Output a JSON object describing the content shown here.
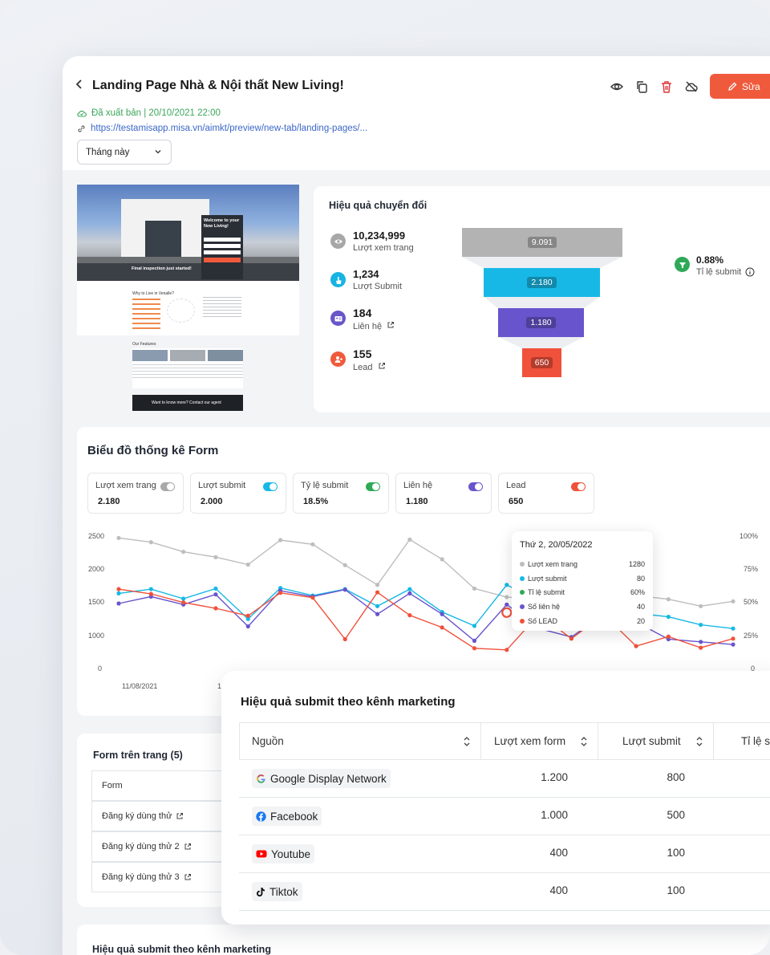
{
  "header": {
    "title": "Landing Page Nhà & Nội thất New Living!",
    "status": "Đã xuất bản | 20/10/2021  22:00",
    "url": "https://testamisapp.misa.vn/aimkt/preview/new-tab/landing-pages/...",
    "period": "Tháng này",
    "edit_label": "Sửa",
    "icons": [
      "eye-icon",
      "copy-icon",
      "trash-icon",
      "cloud-off-icon",
      "pencil-icon"
    ],
    "accent": "#f05a3c"
  },
  "preview": {
    "hero_heading": "Welcome to your New Living!",
    "banner": "Final inspection just started!",
    "section": "Why to Live in Venalle?",
    "features": "Our Features",
    "cta": "Want to know more? Contact our agent"
  },
  "conversion": {
    "title": "Hiệu quả chuyển đổi",
    "metrics": [
      {
        "value": "10,234,999",
        "label": "Lượt xem trang",
        "color": "#a7a7a7",
        "icon": "eye-icon"
      },
      {
        "value": "1,234",
        "label": "Lượt Submit",
        "color": "#17b3e3",
        "icon": "hand-pointer-icon"
      },
      {
        "value": "184",
        "label": "Liên hệ",
        "color": "#6a55c9",
        "icon": "contact-card-icon"
      },
      {
        "value": "155",
        "label": "Lead",
        "color": "#f05a3c",
        "icon": "user-plus-icon"
      }
    ],
    "funnel": [
      {
        "label": "9.091",
        "color": "#b3b3b3"
      },
      {
        "label": "2.180",
        "color": "#17b8e6"
      },
      {
        "label": "1.180",
        "color": "#6854cc"
      },
      {
        "label": "650",
        "color": "#f0513b"
      }
    ],
    "ratio_value": "0.88%",
    "ratio_label": "Tỉ lệ submit"
  },
  "chart_card": {
    "title": "Biểu đồ thống kê Form",
    "stats": [
      {
        "label": "Lượt xem trang",
        "value": "2.180",
        "color": "#a9a9a9"
      },
      {
        "label": "Lượt submit",
        "value": "2.000",
        "color": "#17b8e6"
      },
      {
        "label": "Tỷ lệ submit",
        "value": "18.5%",
        "color": "#2fa958"
      },
      {
        "label": "Liên hệ",
        "value": "1.180",
        "color": "#6854cc"
      },
      {
        "label": "Lead",
        "value": "650",
        "color": "#f0513b"
      }
    ],
    "tooltip": {
      "title": "Thứ 2, 20/05/2022",
      "rows": [
        {
          "label": "Lượt xem trang",
          "value": "1280",
          "color": "#bdbdbd"
        },
        {
          "label": "Lượt submit",
          "value": "80",
          "color": "#17b8e6"
        },
        {
          "label": "Tỉ lệ submit",
          "value": "60%",
          "color": "#2fa958"
        },
        {
          "label": "Số liên hệ",
          "value": "40",
          "color": "#6854cc"
        },
        {
          "label": "Số LEAD",
          "value": "20",
          "color": "#f0513b"
        }
      ]
    }
  },
  "chart_data": {
    "type": "line",
    "x": [
      "11/08/2021",
      "",
      "",
      "",
      "",
      "",
      "",
      "",
      "",
      "",
      "",
      "",
      "",
      "",
      "",
      "",
      "",
      "",
      "",
      ""
    ],
    "x_tick_labels": [
      "11/08/2021",
      "1"
    ],
    "y_left_ticks": [
      "2500",
      "2000",
      "1500",
      "1000",
      "0"
    ],
    "y_right_ticks": [
      "100%",
      "75%",
      "50%",
      "25%",
      "0"
    ],
    "ylim": [
      0,
      2500
    ],
    "series": [
      {
        "color": "#bdbdbd",
        "values": [
          2480,
          2400,
          2220,
          2120,
          1980,
          2440,
          2360,
          1970,
          1600,
          2450,
          2080,
          1530,
          1370,
          1330,
          1480,
          1650,
          1400,
          1330,
          1200,
          1290
        ]
      },
      {
        "color": "#17b8e6",
        "values": [
          1440,
          1520,
          1340,
          1530,
          960,
          1540,
          1400,
          1520,
          1200,
          1520,
          1090,
          830,
          1600,
          1290,
          1020,
          800,
          1070,
          1000,
          850,
          780
        ]
      },
      {
        "color": "#6854cc",
        "values": [
          1250,
          1380,
          1230,
          1420,
          820,
          1490,
          1380,
          1510,
          1050,
          1440,
          1050,
          550,
          1230,
          780,
          620,
          1050,
          900,
          580,
          530,
          480
        ]
      },
      {
        "color": "#f0513b",
        "values": [
          1520,
          1430,
          1270,
          1160,
          1020,
          1450,
          1360,
          580,
          1460,
          1030,
          800,
          410,
          380,
          1050,
          590,
          1040,
          450,
          630,
          420,
          590
        ]
      }
    ],
    "highlight_index": 12
  },
  "forms": {
    "title": "Form trên trang (5)",
    "header": "Form",
    "rows": [
      "Đăng ký dùng thử",
      "Đăng ký dùng thử 2",
      "Đăng ký dùng thử 3"
    ]
  },
  "bottom": {
    "title": "Hiệu quả submit theo kênh marketing"
  },
  "marketing": {
    "title": "Hiệu quả submit theo kênh marketing",
    "columns": [
      "Nguồn",
      "Lượt xem form",
      "Lượt submit",
      "Tỉ lệ su"
    ],
    "rows": [
      {
        "source": "Google Display Network",
        "icon": "google-icon",
        "views": "1.200",
        "submits": "800"
      },
      {
        "source": "Facebook",
        "icon": "facebook-icon",
        "views": "1.000",
        "submits": "500"
      },
      {
        "source": "Youtube",
        "icon": "youtube-icon",
        "views": "400",
        "submits": "100"
      },
      {
        "source": "Tiktok",
        "icon": "tiktok-icon",
        "views": "400",
        "submits": "100"
      }
    ]
  }
}
